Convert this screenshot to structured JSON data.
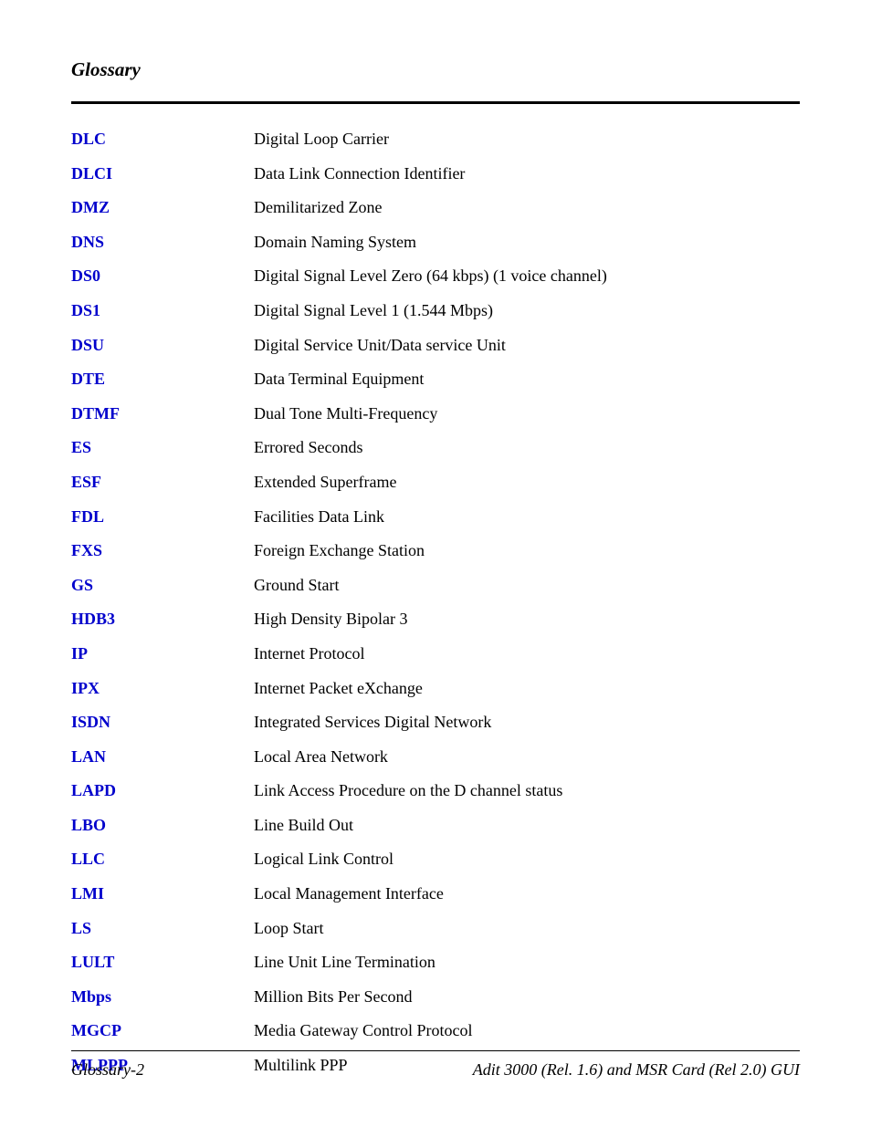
{
  "header": {
    "title": "Glossary"
  },
  "entries": [
    {
      "term": "DLC",
      "def": "Digital Loop Carrier"
    },
    {
      "term": "DLCI",
      "def": "Data Link Connection Identifier"
    },
    {
      "term": "DMZ",
      "def": "Demilitarized Zone"
    },
    {
      "term": "DNS",
      "def": "Domain Naming System"
    },
    {
      "term": "DS0",
      "def": "Digital Signal Level Zero (64 kbps) (1 voice channel)"
    },
    {
      "term": "DS1",
      "def": "Digital Signal Level 1 (1.544 Mbps)"
    },
    {
      "term": "DSU",
      "def": "Digital Service Unit/Data service Unit"
    },
    {
      "term": "DTE",
      "def": "Data Terminal Equipment"
    },
    {
      "term": "DTMF",
      "def": "Dual Tone Multi-Frequency"
    },
    {
      "term": "ES",
      "def": "Errored Seconds"
    },
    {
      "term": "ESF",
      "def": "Extended Superframe"
    },
    {
      "term": "FDL",
      "def": "Facilities Data Link"
    },
    {
      "term": "FXS",
      "def": "Foreign Exchange Station"
    },
    {
      "term": "GS",
      "def": "Ground Start"
    },
    {
      "term": "HDB3",
      "def": "High Density Bipolar 3"
    },
    {
      "term": "IP",
      "def": "Internet Protocol"
    },
    {
      "term": "IPX",
      "def": "Internet Packet eXchange"
    },
    {
      "term": "ISDN",
      "def": "Integrated Services Digital Network"
    },
    {
      "term": "LAN",
      "def": "Local Area Network"
    },
    {
      "term": "LAPD",
      "def": "Link Access Procedure on the D channel status"
    },
    {
      "term": "LBO",
      "def": "Line Build Out"
    },
    {
      "term": "LLC",
      "def": "Logical Link Control"
    },
    {
      "term": "LMI",
      "def": "Local Management Interface"
    },
    {
      "term": "LS",
      "def": "Loop Start"
    },
    {
      "term": "LULT",
      "def": "Line Unit Line Termination"
    },
    {
      "term": "Mbps",
      "def": "Million Bits Per Second"
    },
    {
      "term": "MGCP",
      "def": "Media Gateway Control Protocol"
    },
    {
      "term": "MLPPP",
      "def": "Multilink PPP"
    }
  ],
  "footer": {
    "left": "Glossary-2",
    "right": "Adit 3000 (Rel. 1.6) and MSR Card (Rel 2.0) GUI"
  }
}
